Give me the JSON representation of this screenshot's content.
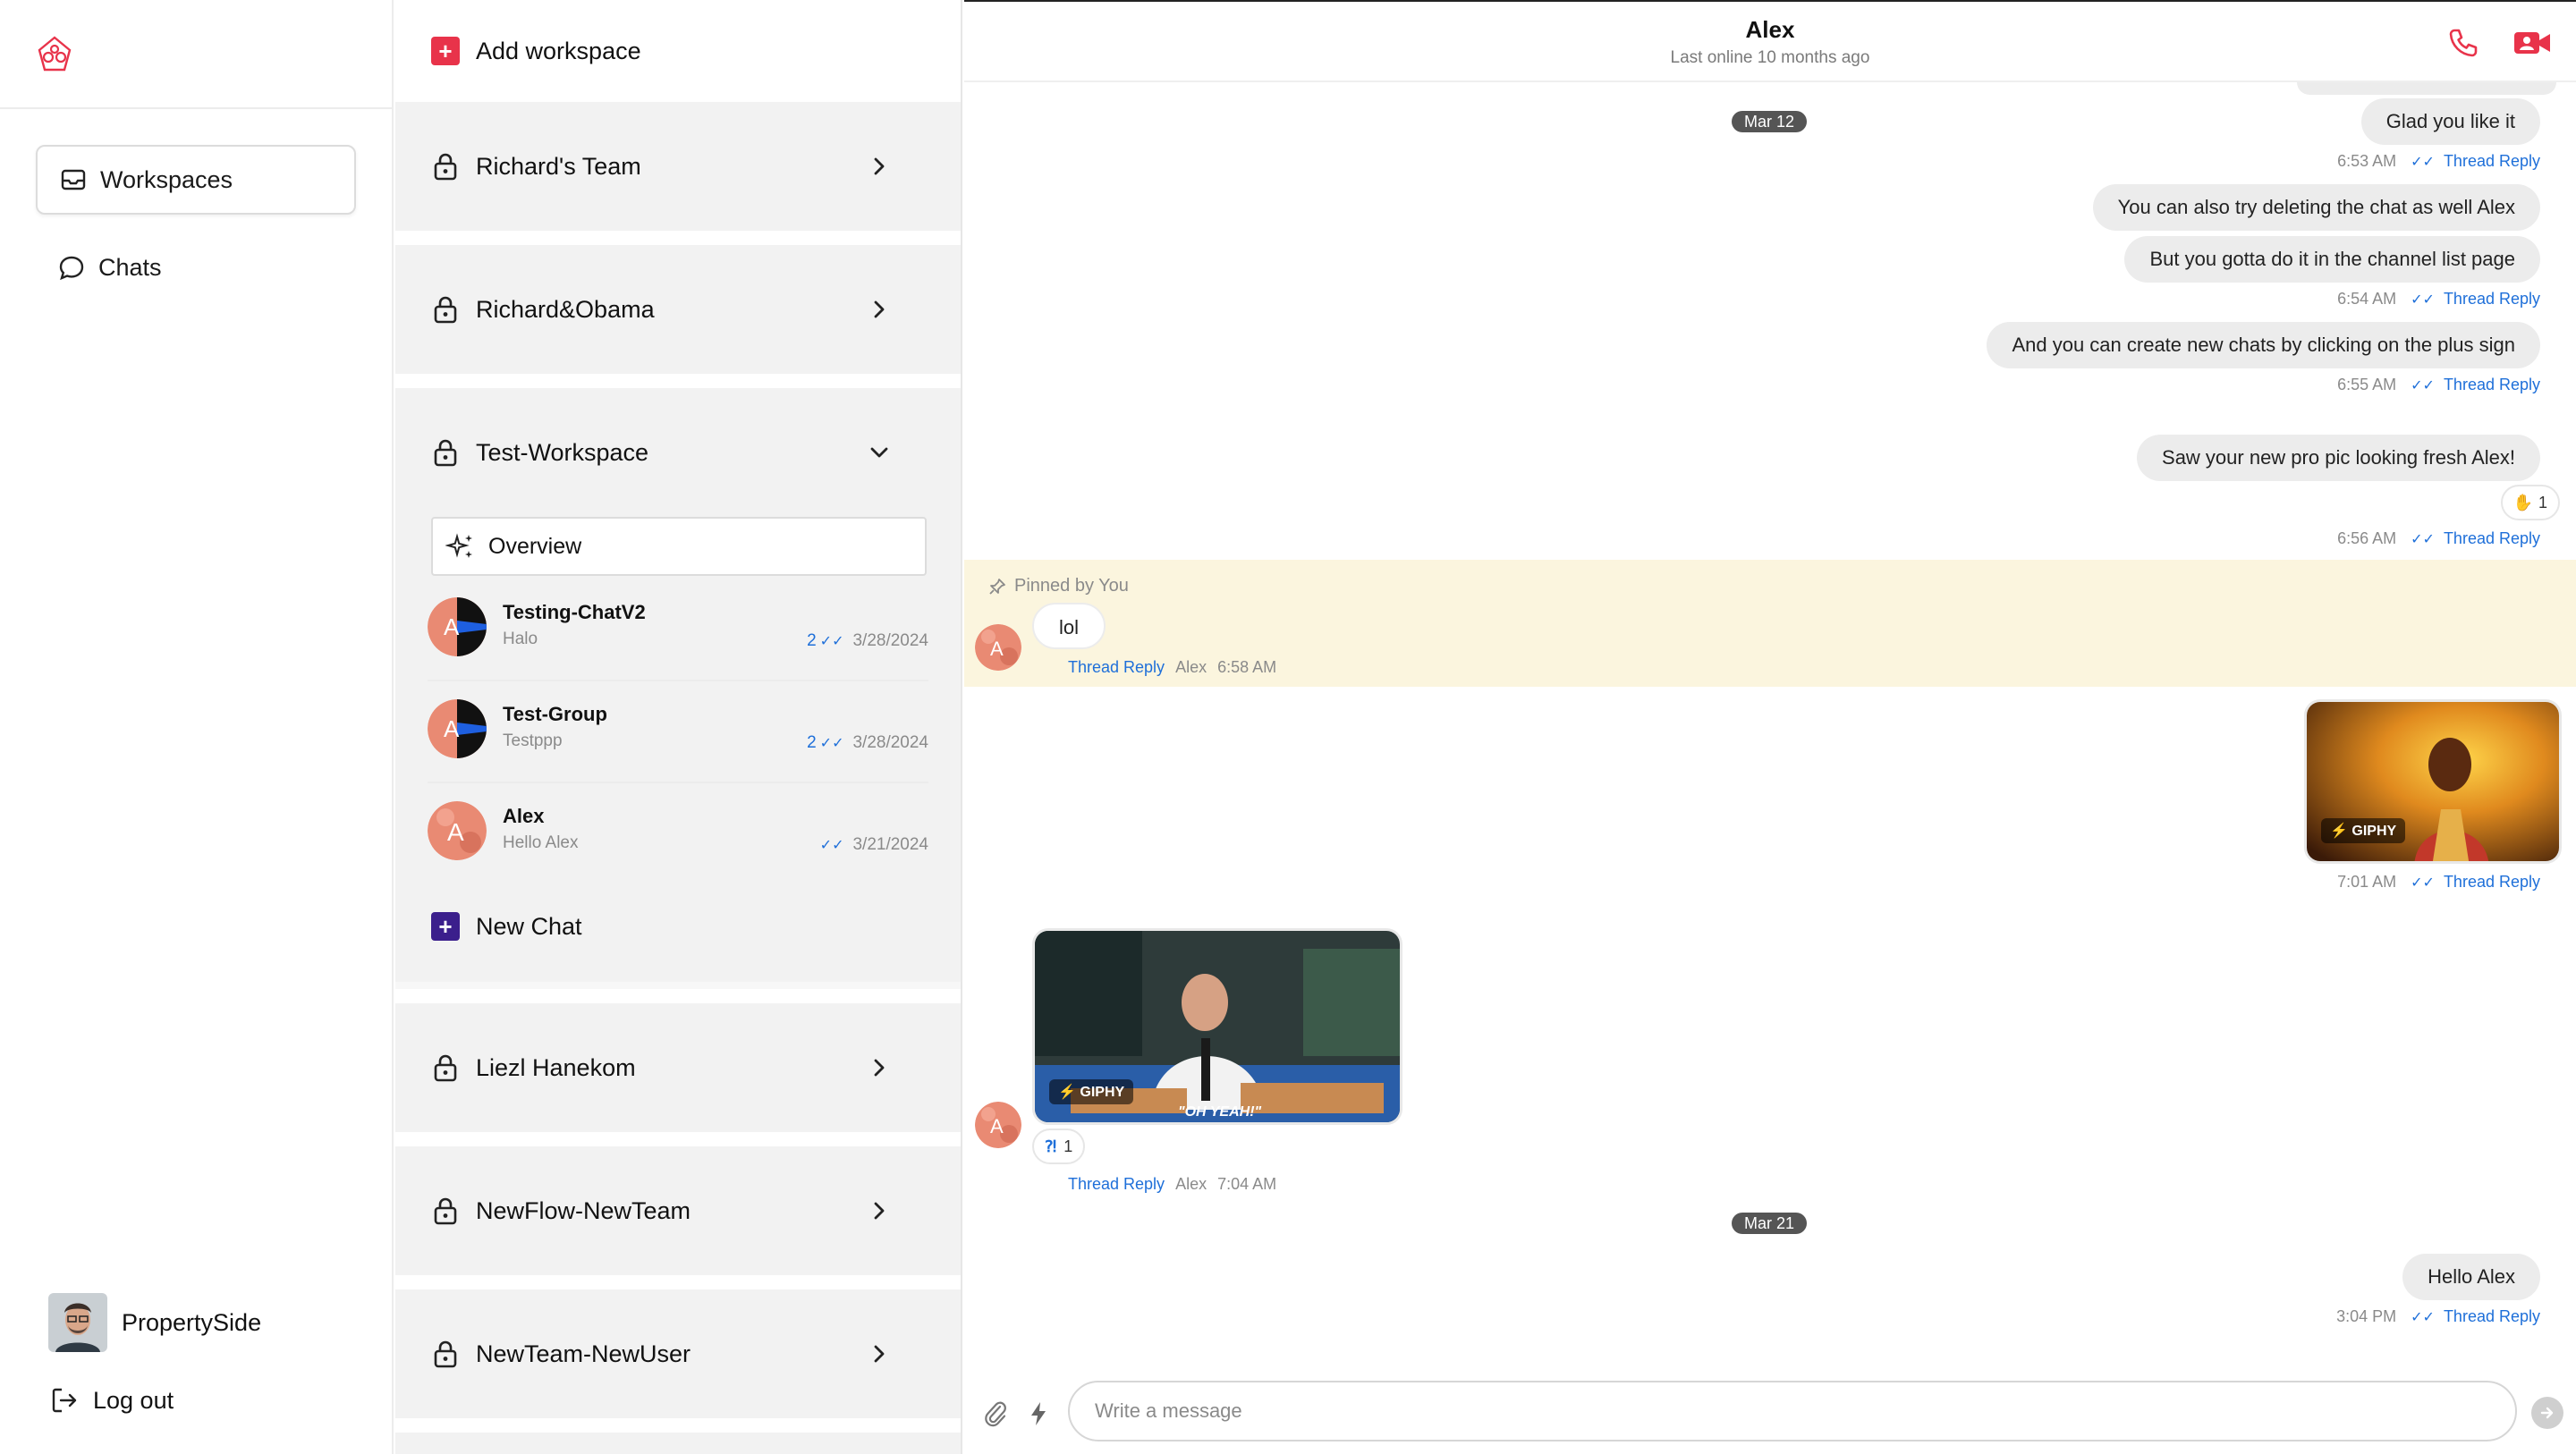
{
  "colors": {
    "brand_red": "#e8334a",
    "new_chat_purple": "#3b1f8c",
    "link_blue": "#1e6fd9",
    "pinned_bg": "#fbf5de"
  },
  "rail": {
    "logo_icon": "brand-logo-icon",
    "nav": [
      {
        "label": "Workspaces",
        "icon": "inbox-icon",
        "active": true
      },
      {
        "label": "Chats",
        "icon": "chat-bubble-icon",
        "active": false
      }
    ],
    "user_name": "PropertySide",
    "logout_label": "Log out"
  },
  "workspaces": {
    "add_label": "Add workspace",
    "items": [
      {
        "name": "Richard's Team",
        "expanded": false
      },
      {
        "name": "Richard&Obama",
        "expanded": false
      },
      {
        "name": "Test-Workspace",
        "expanded": true
      },
      {
        "name": "Liezl Hanekom",
        "expanded": false
      },
      {
        "name": "NewFlow-NewTeam",
        "expanded": false
      },
      {
        "name": "NewTeam-NewUser",
        "expanded": false
      }
    ],
    "overview_label": "Overview",
    "chats": [
      {
        "name": "Testing-ChatV2",
        "preview": "Halo",
        "unread": "2",
        "date": "3/28/2024"
      },
      {
        "name": "Test-Group",
        "preview": "Testppp",
        "unread": "2",
        "date": "3/28/2024"
      },
      {
        "name": "Alex",
        "preview": "Hello Alex",
        "unread": "",
        "date": "3/21/2024"
      }
    ],
    "new_chat_label": "New Chat"
  },
  "chat": {
    "title": "Alex",
    "subtitle": "Last online 10 months ago",
    "date_pills": [
      "Mar 12",
      "Mar 21"
    ],
    "thread_reply": "Thread Reply",
    "messages": {
      "m1": {
        "text": "Glad you like it",
        "time": "6:53 AM"
      },
      "m2": {
        "text": "You can also try deleting the chat as well Alex"
      },
      "m3": {
        "text": "But you gotta do it in the channel list page",
        "time": "6:54 AM"
      },
      "m4": {
        "text": "And you can create new chats by clicking on the plus sign",
        "time": "6:55 AM"
      },
      "m5": {
        "text": "Saw your new pro pic looking fresh Alex!",
        "time": "6:56 AM",
        "reaction": "1"
      },
      "pinned_label": "Pinned by You",
      "m6": {
        "text": "lol",
        "sender": "Alex",
        "time": "6:58 AM"
      },
      "m7": {
        "gif_badge": "GIPHY",
        "time": "7:01 AM"
      },
      "m8": {
        "gif_badge": "GIPHY",
        "gif_caption": "\"OH YEAH!\"",
        "sender": "Alex",
        "time": "7:04 AM",
        "reaction": "1"
      },
      "m9": {
        "text": "Hello Alex",
        "time": "3:04 PM"
      }
    }
  },
  "composer": {
    "placeholder": "Write a message"
  }
}
